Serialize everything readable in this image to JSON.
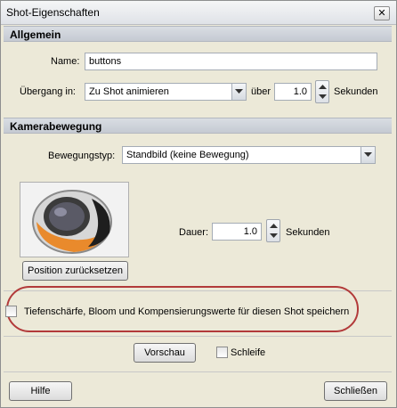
{
  "window": {
    "title": "Shot-Eigenschaften",
    "close_glyph": "✕"
  },
  "allgemein": {
    "header": "Allgemein",
    "name_label": "Name:",
    "name_value": "buttons",
    "transition_label": "Übergang in:",
    "transition_value": "Zu Shot animieren",
    "over_label": "über",
    "duration_value": "1.0",
    "seconds_label": "Sekunden"
  },
  "kamera": {
    "header": "Kamerabewegung",
    "movement_label": "Bewegungstyp:",
    "movement_value": "Standbild (keine Bewegung)",
    "duration_label": "Dauer:",
    "duration_value": "1.0",
    "seconds_label": "Sekunden",
    "reset_button": "Position zurücksetzen"
  },
  "options": {
    "depth_checkbox_label": "Tiefenschärfe, Bloom und Kompensierungswerte für diesen Shot speichern",
    "depth_checked": false,
    "loop_label": "Schleife",
    "loop_checked": false,
    "preview_button": "Vorschau"
  },
  "footer": {
    "help_button": "Hilfe",
    "close_button": "Schließen"
  },
  "colors": {
    "highlight_oval": "#b23a3a",
    "section_header": "#c5cad2"
  }
}
